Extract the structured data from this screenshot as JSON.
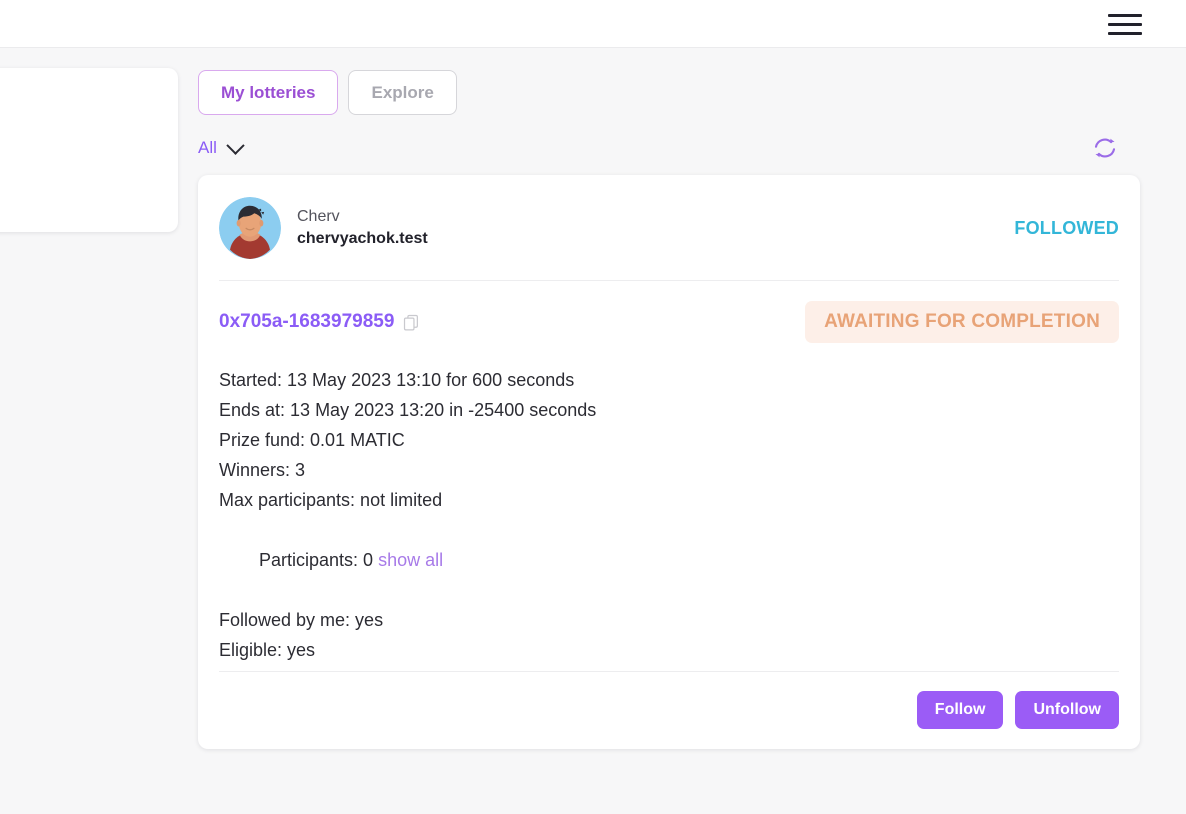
{
  "header": {
    "menu_icon": "hamburger-menu-icon"
  },
  "tabs": [
    {
      "label": "My lotteries",
      "active": true
    },
    {
      "label": "Explore",
      "active": false
    }
  ],
  "filter": {
    "label": "All",
    "chevron_icon": "chevron-down-icon",
    "refresh_icon": "refresh-icon"
  },
  "card": {
    "owner": {
      "name": "Cherv",
      "handle": "chervyachok.test",
      "avatar_icon": "user-avatar"
    },
    "followed_flag": "FOLLOWED",
    "lottery_id": "0x705a-1683979859",
    "copy_icon": "copy-icon",
    "status": "AWAITING FOR COMPLETION",
    "details": [
      "Started: 13 May 2023 13:10 for 600 seconds",
      "Ends at: 13 May 2023 13:20 in -25400 seconds",
      "Prize fund: 0.01 MATIC",
      "Winners: 3",
      "Max participants: not limited"
    ],
    "participants_prefix": "Participants: 0 ",
    "participants_link": "show all",
    "details_after": [
      "Followed by me: yes",
      "Eligible: yes"
    ],
    "actions": [
      {
        "label": "Follow"
      },
      {
        "label": "Unfollow"
      }
    ]
  },
  "colors": {
    "accent_purple": "#8b5cf6",
    "button_purple": "#9b5cf6",
    "followed_cyan": "#33b6d8",
    "status_orange": "#e8a377",
    "status_bg": "#fdefe8",
    "page_bg": "#f7f7f8"
  }
}
